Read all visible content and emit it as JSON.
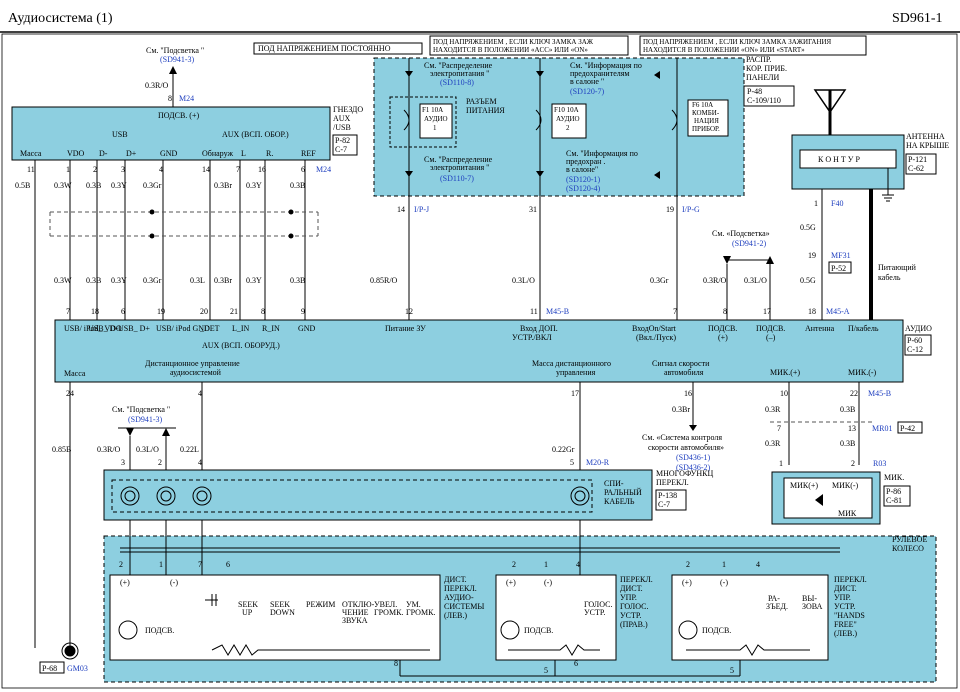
{
  "header": {
    "title": "Аудиосистема (1)",
    "code": "SD961-1"
  },
  "labels": {
    "see_backlight": "См. \"Подсветка \"",
    "sd941_3": "(SD941-3)",
    "w_03r_o": "0.3R/O",
    "pin8": "8",
    "m24": "M24",
    "constant_power": "ПОД НАПРЯЖЕНИЕМ ПОСТОЯННО",
    "acc_on_1": "ПОД НАПРЯЖЕНИЕМ , ЕСЛИ КЛЮЧ ЗАМКА ЗАЖ",
    "acc_on_2": "НАХОДИТСЯ В ПОЛОЖЕНИИ «ACC» ИЛИ «ON»",
    "on_start_1": "ПОД НАПРЯЖЕНИЕМ , ЕСЛИ КЛЮЧ ЗАМКА ЗАЖИГАНИЯ",
    "on_start_2": "НАХОДИТСЯ В ПОЛОЖЕНИИ «ON» ИЛИ «START»",
    "distr_1": "См. \"Распределение",
    "distr_2": "электропитания \"",
    "sd110_8": "(SD110-8)",
    "sd110_7": "(SD110-7)",
    "fuse_info_1": "См. \"Информация по",
    "fuse_info_2": "предохранителям",
    "fuse_info_3": "в салоне \"",
    "sd120_7": "(SD120-7)",
    "fuse_info_b1": "См. \"Информация по",
    "fuse_info_b2": "предохран .",
    "fuse_info_b3": "в салоне\"",
    "sd120_1": "(SD120-1)",
    "sd120_4": "(SD120-4)",
    "power_conn_1": "РАЗЪЕМ",
    "power_conn_2": "ПИТАНИЯ",
    "f1_1": "F1 10A",
    "f1_2": "АУДИО",
    "f1_3": "1",
    "f10_1": "F10 10A",
    "f10_2": "АУДИО",
    "f10_3": "2",
    "f6_1": "F6 10A",
    "f6_2": "КОМБИ-",
    "f6_3": "НАЦИЯ",
    "f6_4": "ПРИБОР.",
    "jb_1": "РАСПР.",
    "jb_2": "КОР. ПРИБ.",
    "jb_3": "ПАНЕЛИ",
    "jb_ref1": "P-48",
    "jb_ref2": "C-109/110",
    "aux_title": "ГНЕЗДО",
    "aux_title2": "AUX",
    "aux_title3": "/USB",
    "aux_ref1": "P-82",
    "aux_ref2": "C-7",
    "aux_backlight": "ПОДСВ. (+)",
    "usb": "USB",
    "aux_group": "AUX (ВСП. ОБОР.)",
    "pin_mass": "Масса",
    "pin_vdo": "VDO",
    "pin_dminus": "D-",
    "pin_dplus": "D+",
    "pin_gnd": "GND",
    "pin_detect": "Обнаруж",
    "pin_l": "L",
    "pin_r": "R.",
    "pin_ref": "REF",
    "antenna_1": "АНТЕННА",
    "antenna_2": "НА КРЫШЕ",
    "antenna_ref1": "P-121",
    "antenna_ref2": "C-62",
    "kontur": "К О Н Т У Р",
    "f40": "F40",
    "w_05g": "0.5G",
    "mf31": "MF31",
    "p52": "P-52",
    "power_cable_1": "Питающий",
    "power_cable_2": "кабель",
    "sd941_2": "(SD941-2)",
    "see_backlight_2": "См. «Подсветка»",
    "audio_1": "АУДИО",
    "audio_ref1": "P-60",
    "audio_ref2": "C-12",
    "a_usb_vdo": "USB/ iPod_ VDO",
    "a_usb_d": "USB_ D-",
    "a_usb_dp": "USB_ D+",
    "a_usb_gnd": "USB/ iPod GND",
    "a_det": "_DET",
    "a_lin": "L_IN",
    "a_rin": "R_IN",
    "a_gnd": "GND",
    "a_aux": "AUX (ВСП. ОБОРУД.)",
    "a_charge": "Питание ЗУ",
    "a_in_1": "Вход ДОП.",
    "a_in_2": "УСТР./ВКЛ",
    "a_onstart_1": "ВходOn/Start",
    "a_onstart_2": "(Вкл./Пуск)",
    "a_bl_plus_1": "ПОДСВ.",
    "a_bl_plus_2": "(+)",
    "a_bl_minus_1": "ПОДСВ.",
    "a_bl_minus_2": "(–)",
    "a_antenna": "Антенна",
    "a_pcable": "П/кабель",
    "a_mass": "Масса",
    "a_remote_1": "Дистанционное управление",
    "a_remote_2": "аудиосистемой",
    "a_remote_gnd_1": "Масса дистанционного",
    "a_remote_gnd_2": "управления",
    "a_speed_1": "Сигнал скорости",
    "a_speed_2": "автомобиля",
    "a_mic_plus": "МИК.(+)",
    "a_mic_minus": "МИК.(-)",
    "m45b": "M45-B",
    "m45a": "M45-A",
    "ipj": "I/P-J",
    "ipg": "I/P-G",
    "w_05b": "0.5B",
    "w_03w": "0.3W",
    "w_03b": "0.3B",
    "w_03y": "0.3Y",
    "w_03gr": "0.3Gr",
    "w_03br": "0.3Br",
    "w_03l": "0.3L",
    "w_085r_o": "0.85R/O",
    "w_03l_o": "0.3L/O",
    "w_03r": "0.3R",
    "w_022l": "0.22L",
    "w_022gr": "0.22Gr",
    "w_085b": "0.85B",
    "mr01": "MR01",
    "p42": "P-42",
    "r03": "R03",
    "m20r": "M20-R",
    "speed_ref_1": "См. «Система контроля",
    "speed_ref_2": "скорости автомобиля»",
    "sd436_1": "(SD436-1)",
    "sd436_2": "(SD436-2)",
    "mic_title": "МИК.",
    "mic_ref1": "P-86",
    "mic_ref2": "C-81",
    "mic_plus": "МИК(+)",
    "mic_minus": "МИК(-)",
    "mic": "МИК",
    "multi_1": "МНОГОФУНКЦ",
    "multi_2": "ПЕРЕКЛ.",
    "multi_ref1": "P-138",
    "multi_ref2": "C-7",
    "spiral_1": "СПИ-",
    "spiral_2": "РАЛЬНЫЙ",
    "spiral_3": "КАБЕЛЬ",
    "wheel_1": "РУЛЕВОЕ",
    "wheel_2": "КОЛЕСО",
    "left_sw_1": "ДИСТ.",
    "left_sw_2": "ПЕРЕКЛ.",
    "left_sw_3": "АУДИО-",
    "left_sw_4": "СИСТЕМЫ",
    "left_sw_5": "(ЛЕВ.)",
    "mid_sw_1": "ПЕРЕКЛ.",
    "mid_sw_2": "ДИСТ.",
    "mid_sw_3": "УПР.",
    "mid_sw_4": "ГОЛОС.",
    "mid_sw_5": "УСТР.",
    "mid_sw_6": "(ПРАВ.)",
    "right_sw_1": "ПЕРЕКЛ.",
    "right_sw_2": "ДИСТ.",
    "right_sw_3": "УПР.",
    "right_sw_4": "УСТР.",
    "right_sw_5": "\"HANDS",
    "right_sw_6": "FREE\"",
    "right_sw_7": "(ЛЕВ.)",
    "seek_up_1": "SEEK",
    "seek_up_2": "UP",
    "seek_down_1": "SEEK",
    "seek_down_2": "DOWN",
    "mode": "РЕЖИМ",
    "mute_1": "ОТКЛЮ-",
    "mute_2": "ЧЕНИЕ",
    "mute_3": "ЗВУКА",
    "volup_1": "УВЕЛ.",
    "volup_2": "ГРОМК.",
    "voldn_1": "УМ.",
    "voldn_2": "ГРОМК.",
    "voice_1": "ГОЛОС.",
    "voice_2": "УСТР.",
    "call_end_1": "РА-",
    "call_end_2": "ЗЪЕД.",
    "call_1": "ВЫ-",
    "call_2": "ЗОВА",
    "podsv": "ПОДСВ.",
    "gm03": "GM03",
    "p68": "P-68",
    "plus": "(+)",
    "minus": "(-)",
    "minus2": "(–)"
  },
  "colors": {
    "block_fill": "#8dcfe0",
    "ref_blue": "#1f3fbf"
  }
}
